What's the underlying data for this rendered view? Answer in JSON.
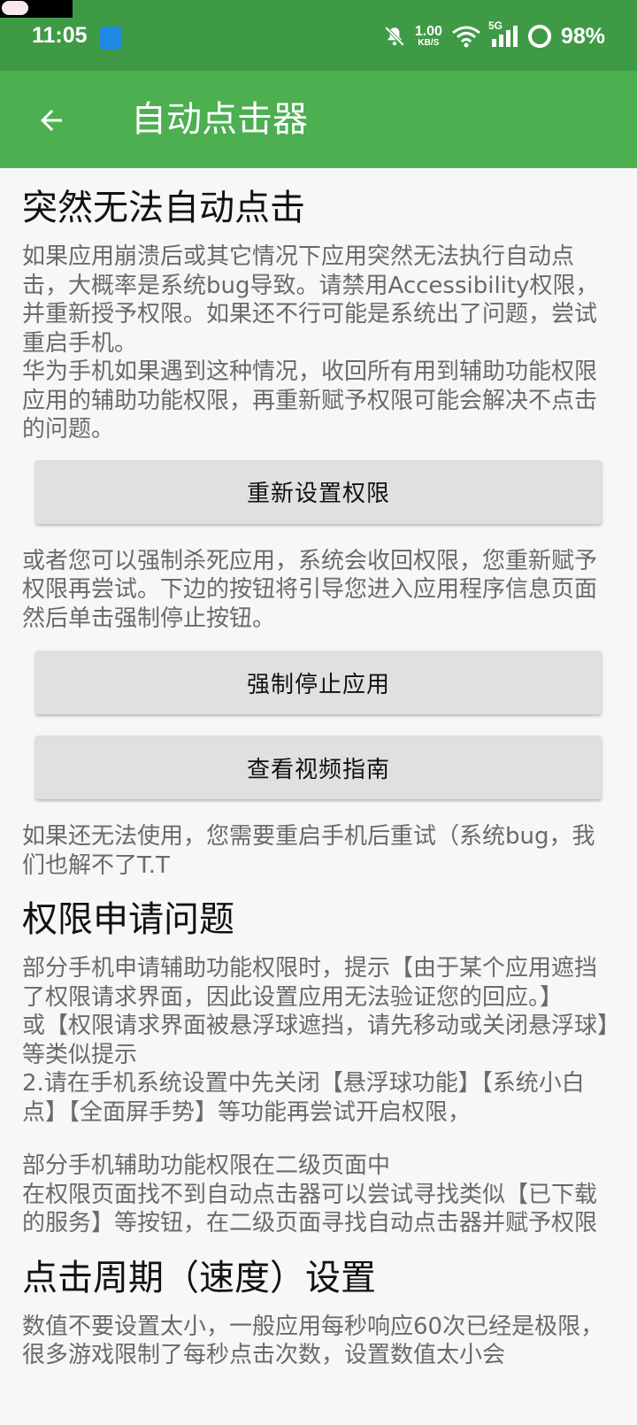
{
  "status_bar": {
    "time": "11:05",
    "net_speed_value": "1.00",
    "net_speed_unit": "KB/S",
    "network": "5G",
    "battery": "98%"
  },
  "app_bar": {
    "title": "自动点击器"
  },
  "sections": {
    "sudden": {
      "heading": "突然无法自动点击",
      "para1": "如果应用崩溃后或其它情况下应用突然无法执行自动点击，大概率是系统bug导致。请禁用Accessibility权限，并重新授予权限。如果还不行可能是系统出了问题，尝试重启手机。\n华为手机如果遇到这种情况，收回所有用到辅助功能权限应用的辅助功能权限，再重新赋予权限可能会解决不点击的问题。",
      "reset_button": "重新设置权限",
      "para2": "或者您可以强制杀死应用，系统会收回权限，您重新赋予权限再尝试。下边的按钮将引导您进入应用程序信息页面然后单击强制停止按钮。",
      "force_stop_button": "强制停止应用",
      "video_button": "查看视频指南",
      "para3": "如果还无法使用，您需要重启手机后重试（系统bug，我们也解不了T.T"
    },
    "permission": {
      "heading": "权限申请问题",
      "para1": "部分手机申请辅助功能权限时，提示【由于某个应用遮挡了权限请求界面，因此设置应用无法验证您的回应。】\n或【权限请求界面被悬浮球遮挡，请先移动或关闭悬浮球】等类似提示\n2.请在手机系统设置中先关闭【悬浮球功能】【系统小白点】【全面屏手势】等功能再尝试开启权限，",
      "para2": "部分手机辅助功能权限在二级页面中\n在权限页面找不到自动点击器可以尝试寻找类似【已下载的服务】等按钮，在二级页面寻找自动点击器并赋予权限"
    },
    "speed": {
      "heading": "点击周期（速度）设置",
      "para1": "数值不要设置太小，一般应用每秒响应60次已经是极限，很多游戏限制了每秒点击次数，设置数值太小会"
    }
  }
}
